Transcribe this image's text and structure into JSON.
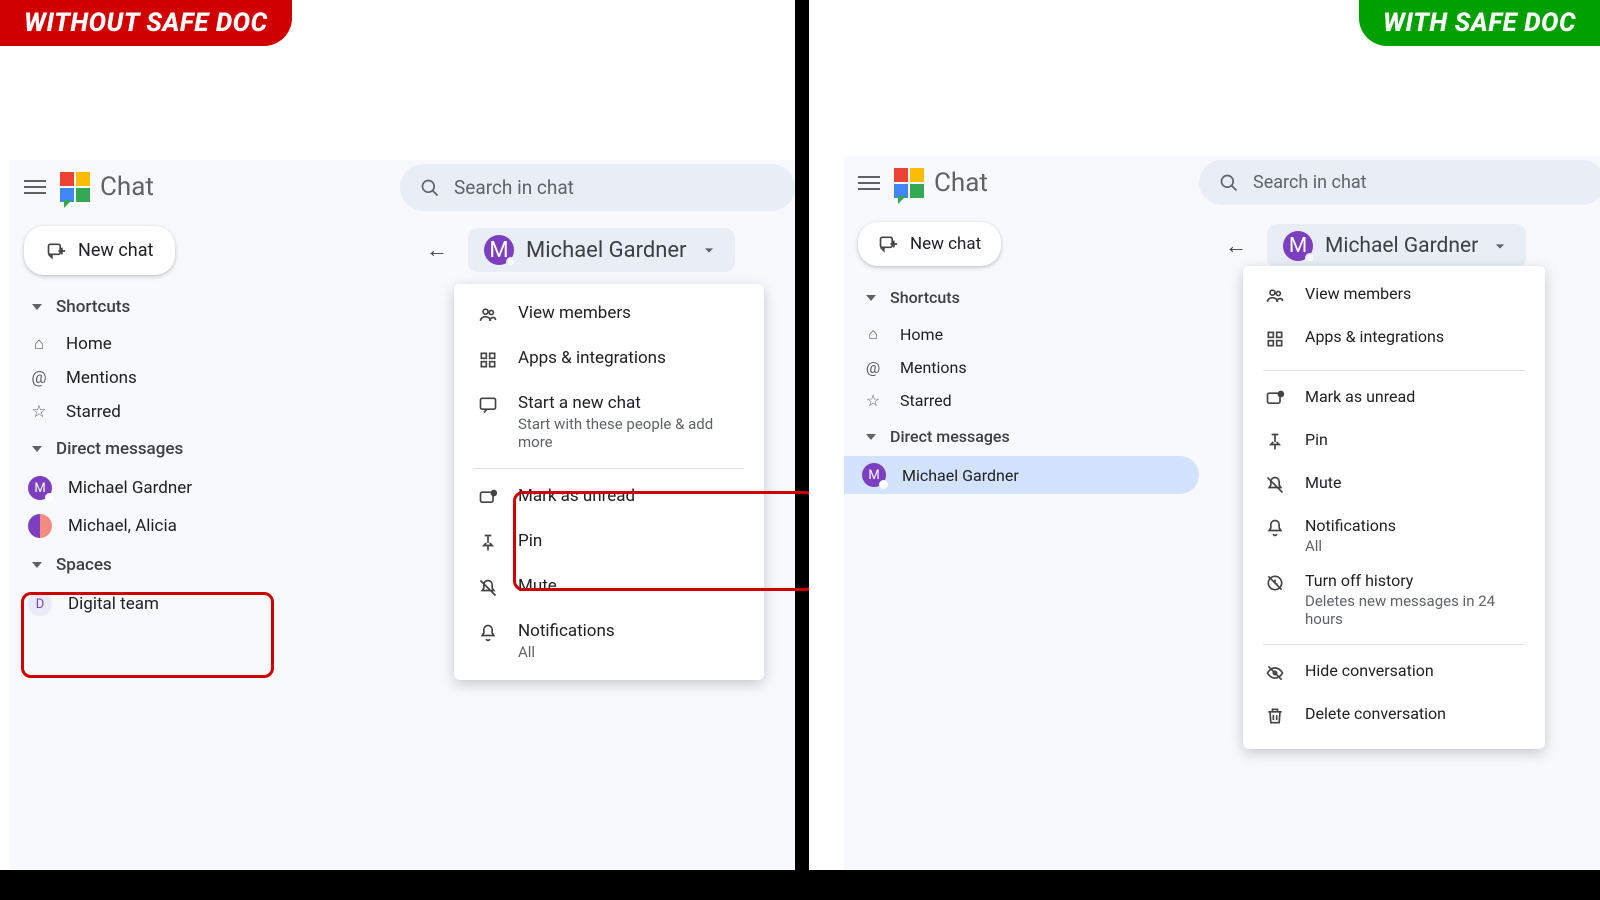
{
  "badges": {
    "without": "WITHOUT SAFE DOC",
    "with": "WITH SAFE DOC"
  },
  "app": {
    "title": "Chat",
    "new_chat": "New chat",
    "search_placeholder": "Search in chat"
  },
  "shortcuts": {
    "header": "Shortcuts",
    "home": "Home",
    "mentions": "Mentions",
    "starred": "Starred"
  },
  "dm": {
    "header": "Direct messages",
    "items": [
      "Michael Gardner",
      "Michael, Alicia"
    ]
  },
  "spaces": {
    "header": "Spaces",
    "items": [
      "Digital team"
    ]
  },
  "person": {
    "name": "Michael Gardner",
    "initial": "M"
  },
  "menu": {
    "view_members": "View members",
    "apps": "Apps & integrations",
    "start_chat": "Start a new chat",
    "start_chat_sub": "Start with these people & add more",
    "mark_unread": "Mark as unread",
    "pin": "Pin",
    "mute": "Mute",
    "notifications": "Notifications",
    "notifications_sub": "All",
    "history": "Turn off history",
    "history_sub": "Deletes new messages in 24 hours",
    "hide": "Hide conversation",
    "delete": "Delete conversation"
  }
}
